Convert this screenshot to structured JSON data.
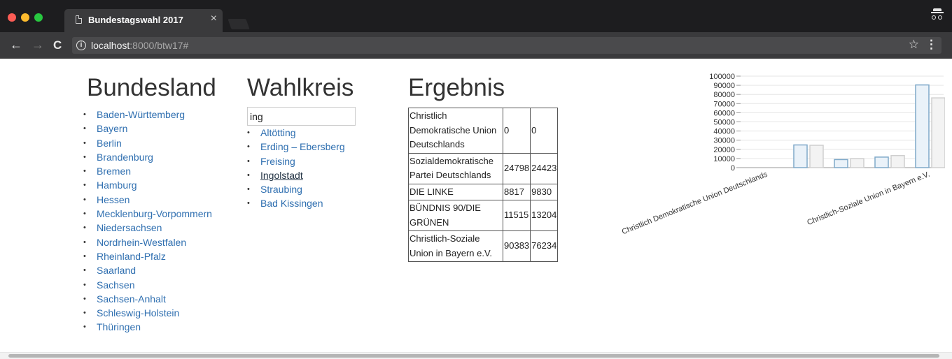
{
  "browser": {
    "tab_title": "Bundestagswahl 2017",
    "tab_close": "×",
    "url_host": "localhost",
    "url_rest": ":8000/btw17#"
  },
  "bundesland": {
    "heading": "Bundesland",
    "items": [
      "Baden-Württemberg",
      "Bayern",
      "Berlin",
      "Brandenburg",
      "Bremen",
      "Hamburg",
      "Hessen",
      "Mecklenburg-Vorpommern",
      "Niedersachsen",
      "Nordrhein-Westfalen",
      "Rheinland-Pfalz",
      "Saarland",
      "Sachsen",
      "Sachsen-Anhalt",
      "Schleswig-Holstein",
      "Thüringen"
    ]
  },
  "wahlkreis": {
    "heading": "Wahlkreis",
    "search_value": "ing",
    "items": [
      "Altötting",
      "Erding – Ebersberg",
      "Freising",
      "Ingolstadt",
      "Straubing",
      "Bad Kissingen"
    ],
    "active": "Ingolstadt"
  },
  "ergebnis": {
    "heading": "Ergebnis",
    "rows": [
      {
        "party": "Christlich Demokratische Union Deutschlands",
        "a": "0",
        "b": "0"
      },
      {
        "party": "Sozialdemokratische Partei Deutschlands",
        "a": "24798",
        "b": "24423"
      },
      {
        "party": "DIE LINKE",
        "a": "8817",
        "b": "9830"
      },
      {
        "party": "BÜNDNIS 90/DIE GRÜNEN",
        "a": "11515",
        "b": "13204"
      },
      {
        "party": "Christlich-Soziale Union in Bayern e.V.",
        "a": "90383",
        "b": "76234"
      }
    ]
  },
  "chart_data": {
    "type": "bar",
    "categories": [
      "Christlich Demokratische Union Deutschlands",
      "Sozialdemokratische Partei Deutschlands",
      "DIE LINKE",
      "BÜNDNIS 90/DIE GRÜNEN",
      "Christlich-Soziale Union in Bayern e.V."
    ],
    "shown_tick_labels": [
      "Christlich Demokratische Union Deutschlands",
      "Christlich-Soziale Union in Bayern e.V."
    ],
    "series": [
      {
        "values": [
          0,
          24798,
          8817,
          11515,
          90383
        ],
        "color": "#7fa9c9",
        "fill": "#eaf2f9"
      },
      {
        "values": [
          0,
          24423,
          9830,
          13204,
          76234
        ],
        "color": "#cfcfcf",
        "fill": "#f3f3f3"
      }
    ],
    "yticks": [
      0,
      10000,
      20000,
      30000,
      40000,
      50000,
      60000,
      70000,
      80000,
      90000,
      100000
    ],
    "ylim": [
      0,
      100000
    ],
    "grid": true,
    "legend": "none"
  }
}
